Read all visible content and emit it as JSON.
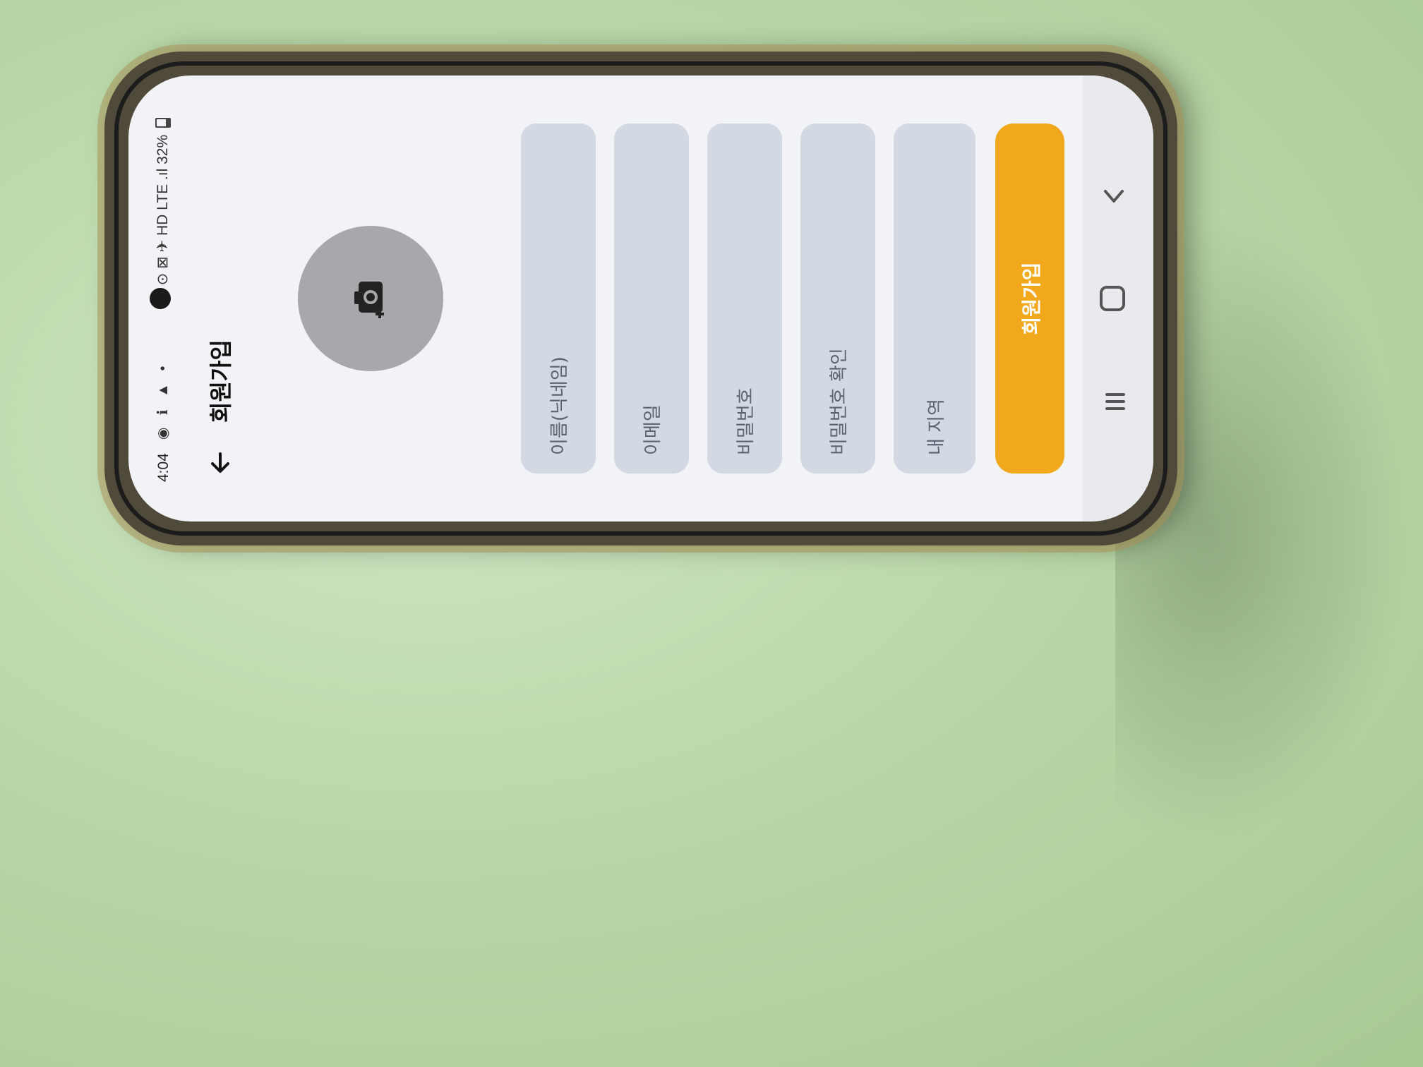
{
  "status_bar": {
    "time": "4:04",
    "left_icons": "◉ ℹ ▲ •",
    "right_icons": "⊙ ⊠ ✈ HD LTE .ıl",
    "battery": "32%"
  },
  "header": {
    "title": "회원가입",
    "back_icon": "arrow-left-icon"
  },
  "profile": {
    "avatar_icon": "add-photo-camera-icon"
  },
  "form": {
    "name_placeholder": "이름(닉네임)",
    "email_placeholder": "이메일",
    "password_placeholder": "비밀번호",
    "password_confirm_placeholder": "비밀번호 확인",
    "region_placeholder": "내 지역"
  },
  "actions": {
    "submit_label": "회원가입",
    "submit_color": "#f1a81c"
  },
  "nav": {
    "recent_icon": "recent-apps-icon",
    "home_icon": "home-icon",
    "back_icon": "chevron-back-icon"
  }
}
